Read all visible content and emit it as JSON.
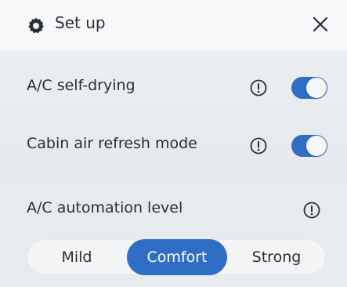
{
  "header": {
    "title": "Set up",
    "gear_icon": "gear-icon",
    "close_icon": "close-icon"
  },
  "settings": [
    {
      "label": "A/C self-drying",
      "info_icon": "info-icon",
      "toggle_on": true
    },
    {
      "label": "Cabin air refresh mode",
      "info_icon": "info-icon",
      "toggle_on": true
    }
  ],
  "automation": {
    "label": "A/C automation level",
    "info_icon": "info-icon",
    "options": [
      "Mild",
      "Comfort",
      "Strong"
    ],
    "selected": "Comfort"
  },
  "colors": {
    "accent": "#2f6ec4",
    "text": "#2a2e33",
    "panel_bg": "#e9ecf0"
  }
}
